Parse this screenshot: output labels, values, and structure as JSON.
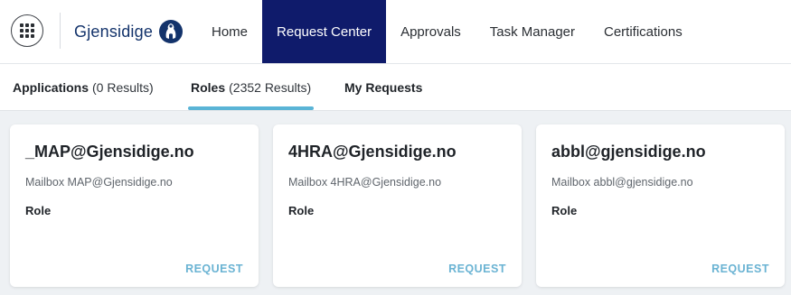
{
  "header": {
    "logo_text": "Gjensidige",
    "nav": [
      {
        "label": "Home"
      },
      {
        "label": "Request Center"
      },
      {
        "label": "Approvals"
      },
      {
        "label": "Task Manager"
      },
      {
        "label": "Certifications"
      }
    ],
    "active_nav": "Request Center"
  },
  "tabs": [
    {
      "label": "Applications",
      "count": "(0 Results)"
    },
    {
      "label": "Roles",
      "count": "(2352 Results)"
    },
    {
      "label": "My Requests",
      "count": ""
    }
  ],
  "active_tab": "Roles",
  "cards": [
    {
      "title": "_MAP@Gjensidige.no",
      "subtitle": "Mailbox MAP@Gjensidige.no",
      "type": "Role",
      "action": "REQUEST"
    },
    {
      "title": "4HRA@Gjensidige.no",
      "subtitle": "Mailbox 4HRA@Gjensidige.no",
      "type": "Role",
      "action": "REQUEST"
    },
    {
      "title": "abbl@gjensidige.no",
      "subtitle": "Mailbox abbl@gjensidige.no",
      "type": "Role",
      "action": "REQUEST"
    }
  ],
  "colors": {
    "nav_active_bg": "#0f1b6b",
    "tab_underline": "#5ab4d6",
    "request_link": "#6ab3d3",
    "logo": "#13336b"
  }
}
